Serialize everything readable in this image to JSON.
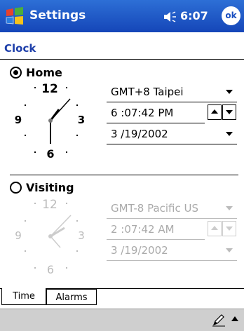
{
  "titlebar": {
    "title": "Settings",
    "time": "6:07",
    "ok_label": "ok"
  },
  "page": {
    "heading": "Clock"
  },
  "home": {
    "label": "Home",
    "selected": true,
    "timezone": "GMT+8 Taipei",
    "time": "6 :07:42 PM",
    "date": "3 /19/2002",
    "dial": {
      "n12": "12",
      "n3": "3",
      "n6": "6",
      "n9": "9"
    }
  },
  "visiting": {
    "label": "Visiting",
    "selected": false,
    "timezone": "GMT-8 Pacific US",
    "time": "2 :07:42 AM",
    "date": "3 /19/2002",
    "dial": {
      "n12": "12",
      "n3": "3",
      "n6": "6",
      "n9": "9"
    }
  },
  "tabs": [
    {
      "label": "Time",
      "active": true
    },
    {
      "label": "Alarms",
      "active": false
    }
  ],
  "icons": {
    "start": "windows-flag-icon",
    "volume": "speaker-icon",
    "input": "pen-icon",
    "menu": "up-arrow-icon"
  },
  "colors": {
    "titlebar": "#1a4fc0",
    "heading": "#1e3faa",
    "dimmed": "#aaaaaa",
    "bottom_bar": "#cfcfcf"
  }
}
